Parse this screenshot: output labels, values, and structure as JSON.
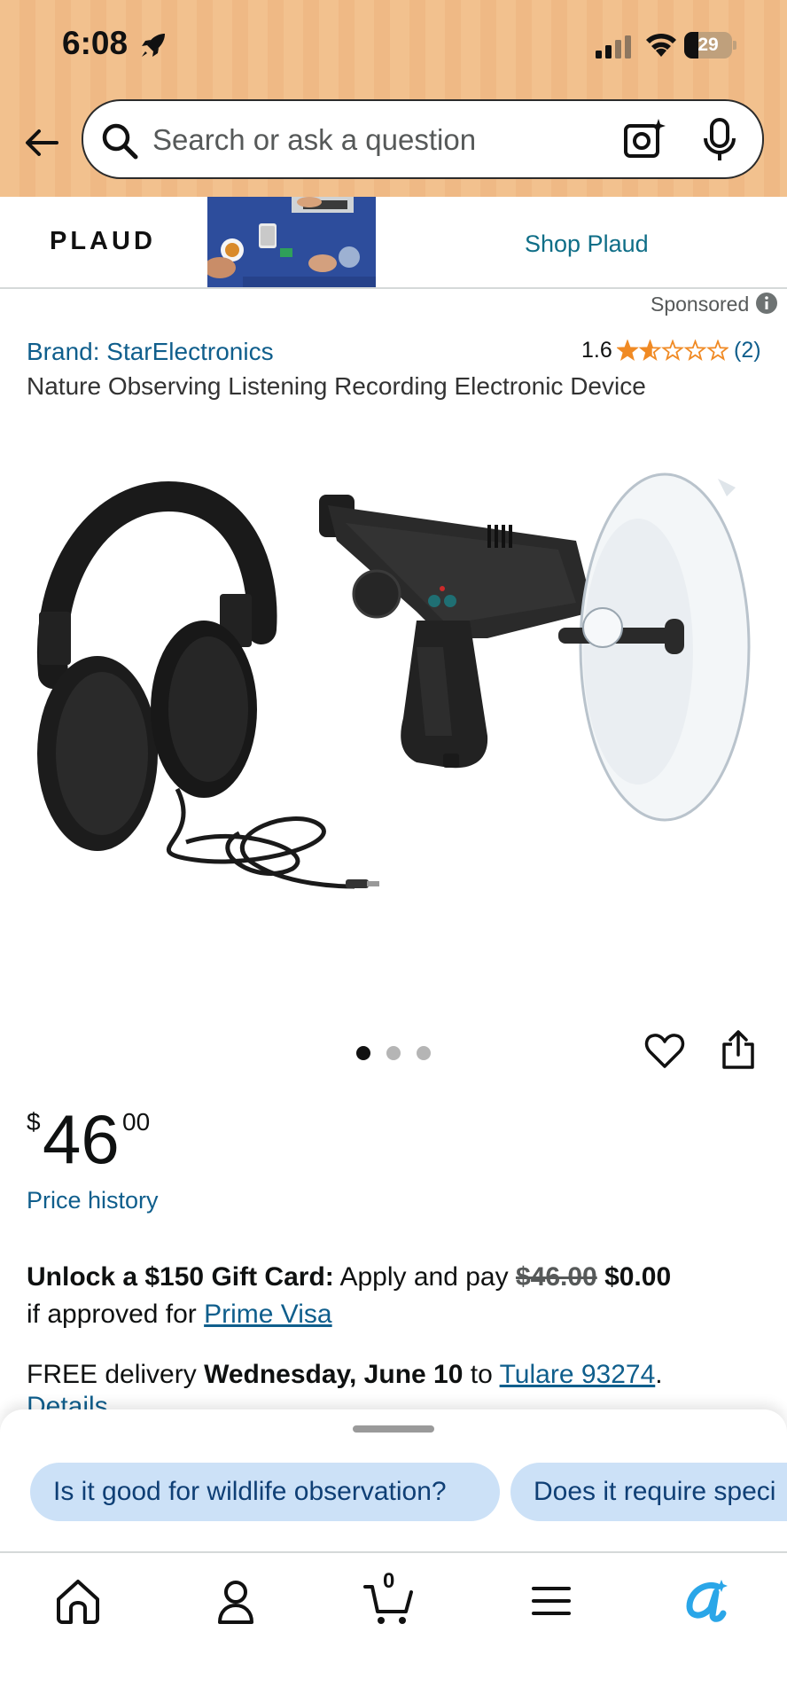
{
  "status_bar": {
    "time": "6:08",
    "battery": "29",
    "battery_level": 0.29
  },
  "search": {
    "placeholder": "Search or ask a question"
  },
  "banner": {
    "brand": "PLAUD",
    "cta": "Shop Plaud"
  },
  "sponsored_label": "Sponsored",
  "product": {
    "brand": "Brand: StarElectronics",
    "rating": "1.6",
    "rating_stars": 1.6,
    "rating_count": "(2)",
    "title": "Nature Observing Listening Recording Electronic Device",
    "image_count": 3,
    "image_index": 1
  },
  "price": {
    "symbol": "$",
    "whole": "46",
    "fraction": "00",
    "history_link": "Price history"
  },
  "promo": {
    "bold": "Unlock a $150 Gift Card:",
    "text": "Apply and pay",
    "old_price": "$46.00",
    "new_price": "$0.00",
    "line2": "if approved for",
    "link": "Prime Visa"
  },
  "delivery": {
    "prefix": "FREE delivery",
    "date": "Wednesday, June 10",
    "to": "to",
    "location": "Tulare 93274",
    "period": ".",
    "details": "Details"
  },
  "suggestions": [
    "Is it good for wildlife observation?",
    "Does it require speci"
  ],
  "nav": {
    "cart_count": "0"
  },
  "colors": {
    "header_bg": "#f2c18e",
    "link": "#0f5e8c",
    "star": "#f08a24",
    "chip_bg": "#cce1f7",
    "rufus": "#2aa6e8"
  }
}
